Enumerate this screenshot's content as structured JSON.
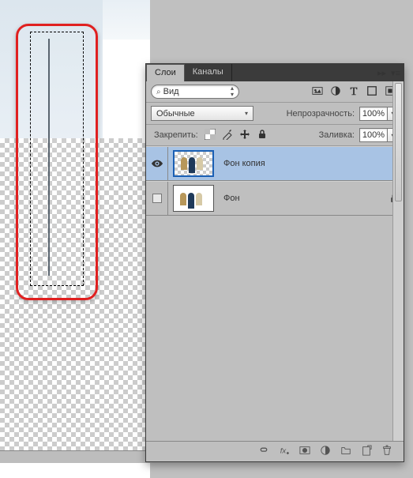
{
  "tabs": {
    "layers": "Слои",
    "channels": "Каналы"
  },
  "search": {
    "label": "Вид"
  },
  "blend_mode": {
    "selected": "Обычные"
  },
  "opacity": {
    "label": "Непрозрачность:",
    "value": "100%"
  },
  "lock": {
    "label": "Закрепить:"
  },
  "fill": {
    "label": "Заливка:",
    "value": "100%"
  },
  "layers_list": [
    {
      "name": "Фон копия",
      "visible": true,
      "locked": false
    },
    {
      "name": "Фон",
      "visible": false,
      "locked": true
    }
  ]
}
